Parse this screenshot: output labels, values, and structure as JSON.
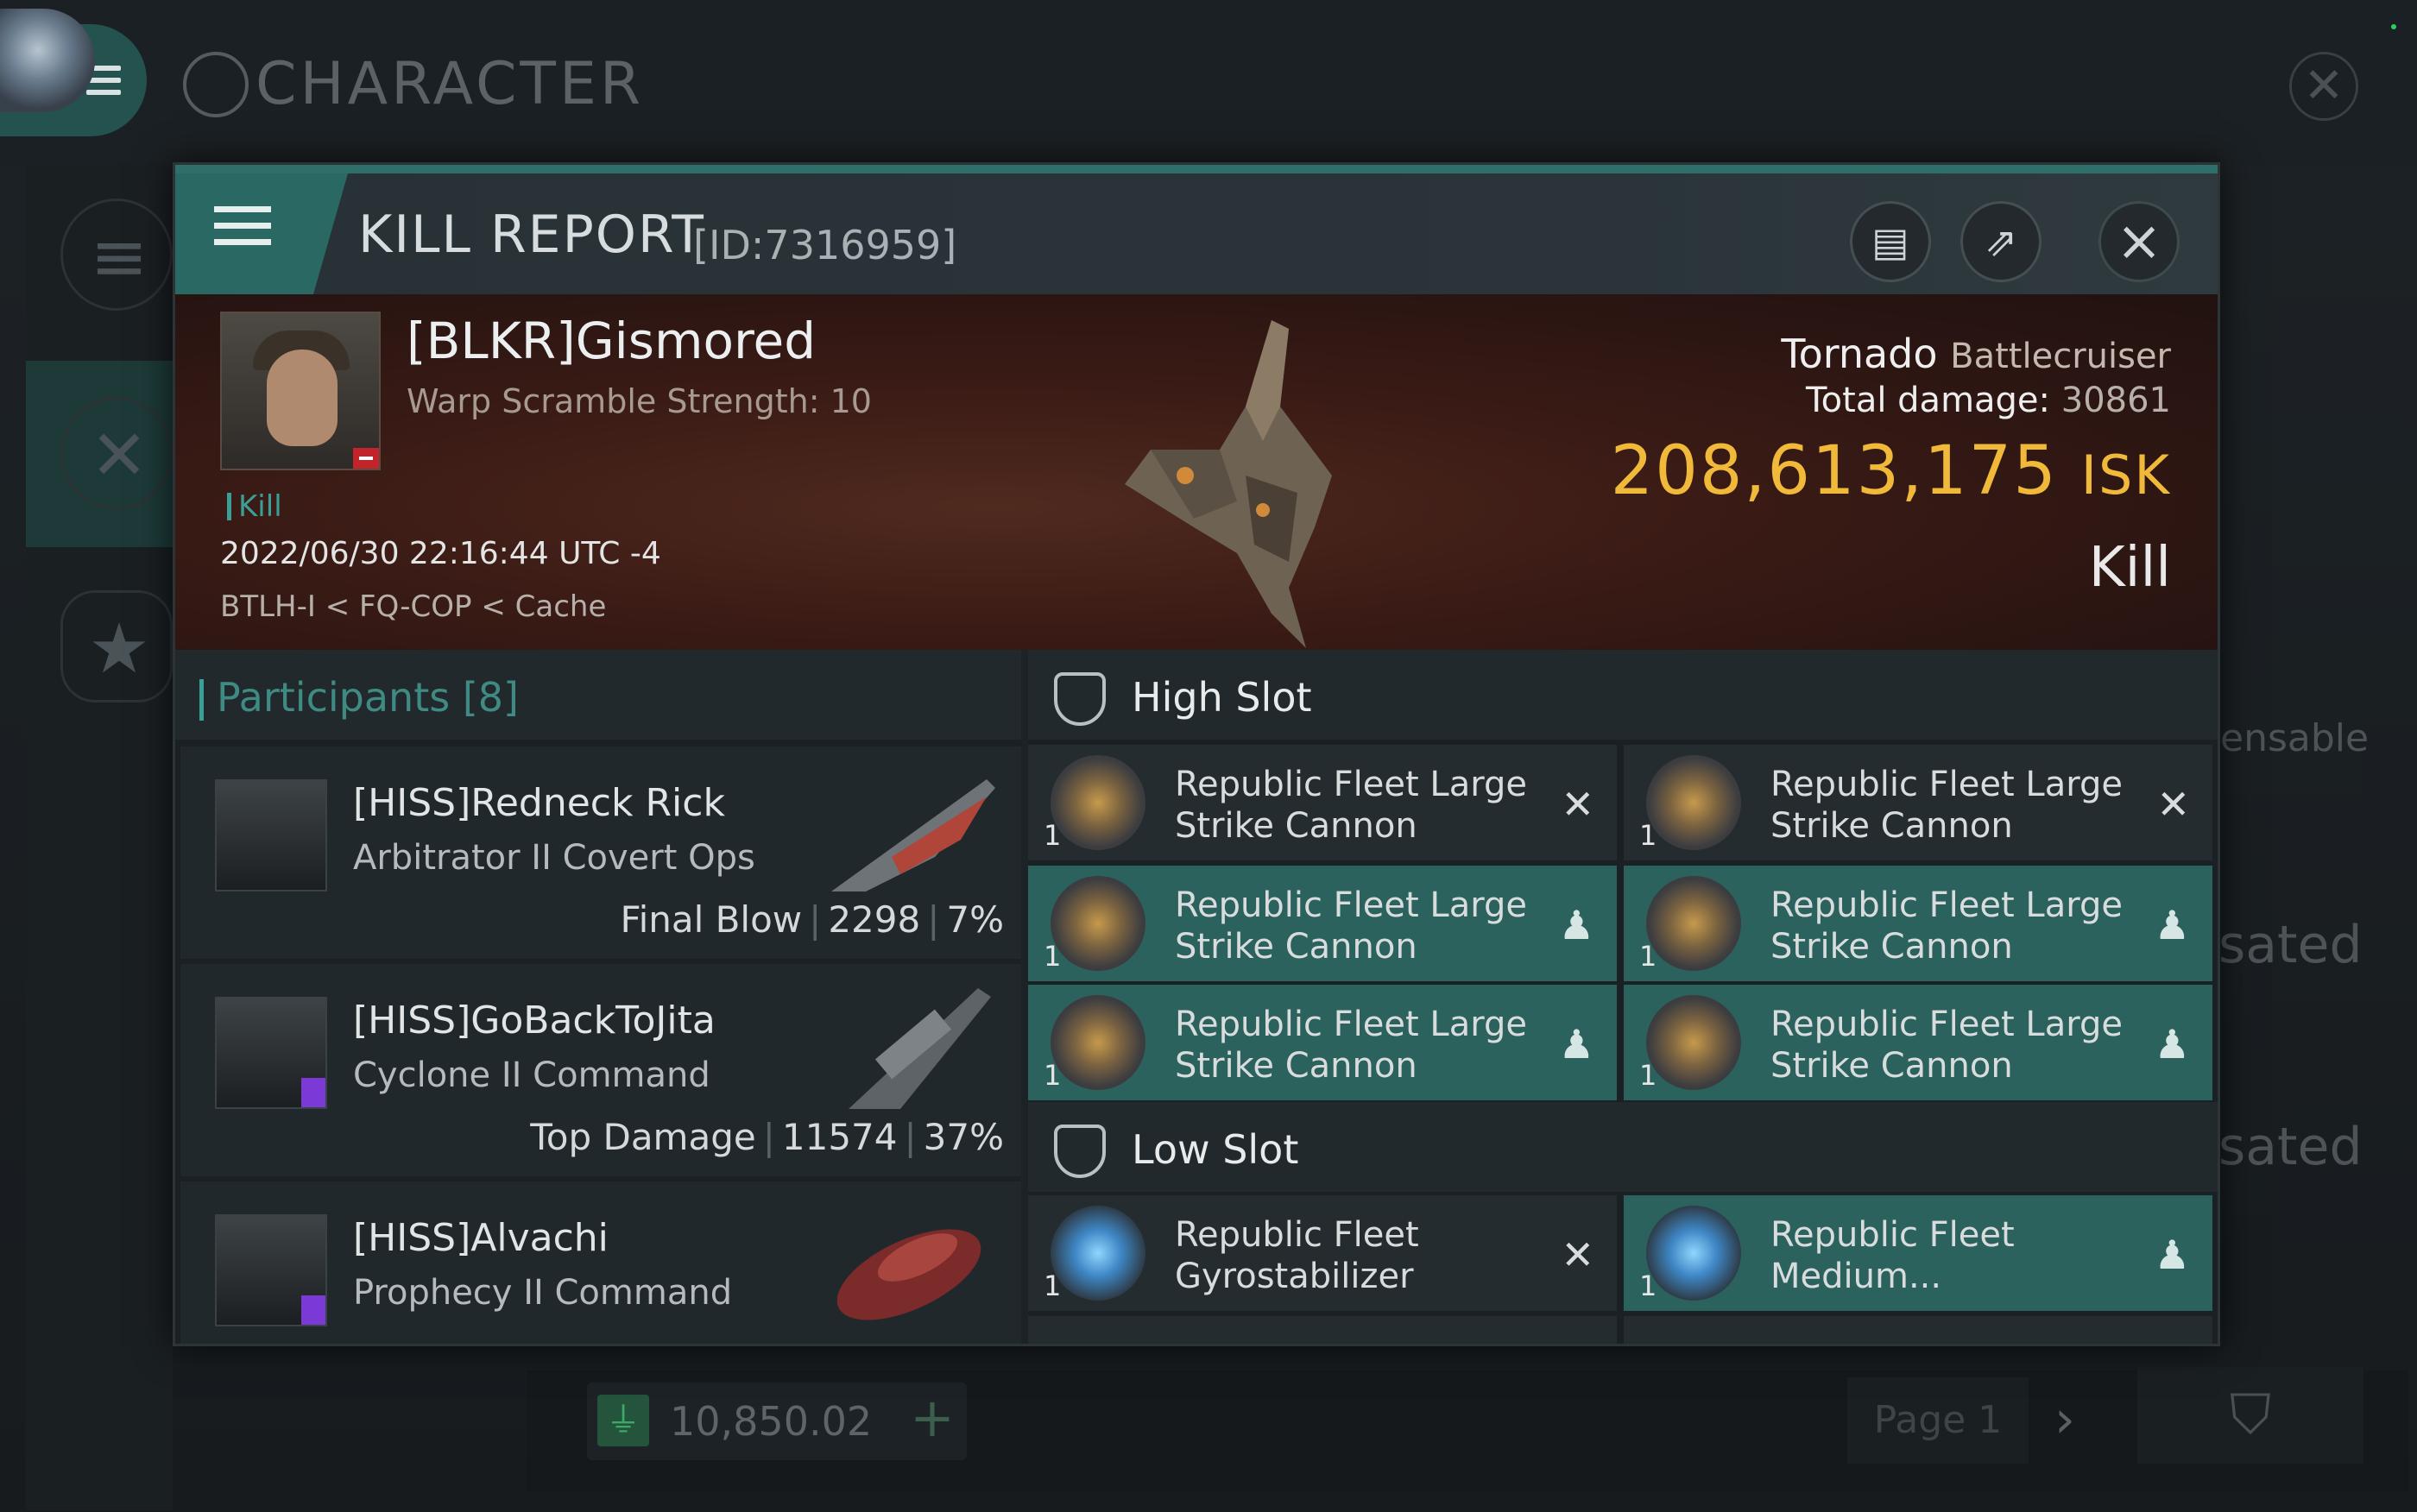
{
  "background": {
    "title": "CHARACTER",
    "right_texts": [
      "ensable",
      "sated",
      "sated"
    ],
    "wallet": "10,850.02",
    "page_label": "Page 1"
  },
  "kill_report": {
    "title": "KILL REPORT",
    "id_label": "[ID:7316959]",
    "victim": {
      "name": "[BLKR]Gismored",
      "warp_line": "Warp Scramble Strength: 10",
      "tag": "Kill",
      "datetime": "2022/06/30 22:16:44 UTC -4",
      "location": "BTLH-I < FQ-COP < Cache"
    },
    "ship": {
      "name": "Tornado",
      "class": "Battlecruiser",
      "total_damage_label": "Total damage:",
      "total_damage": "30861",
      "isk_value": "208,613,175",
      "isk_unit": "ISK",
      "result": "Kill"
    },
    "participants": {
      "label": "Participants",
      "count": "[8]",
      "rows": [
        {
          "name": "[HISS]Redneck Rick",
          "ship": "Arbitrator II Covert Ops",
          "stat_label": "Final Blow",
          "damage": "2298",
          "percent": "7%"
        },
        {
          "name": "[HISS]GoBackToJita",
          "ship": "Cyclone II Command",
          "stat_label": "Top Damage",
          "damage": "11574",
          "percent": "37%"
        },
        {
          "name": "[HISS]Alvachi",
          "ship": "Prophecy II Command",
          "stat_label": "",
          "damage": "",
          "percent": ""
        }
      ]
    },
    "high_slot": {
      "label": "High Slot",
      "modules": [
        {
          "name": "Republic Fleet Large Strike Cannon",
          "qty": "1",
          "state": "destroyed"
        },
        {
          "name": "Republic Fleet Large Strike Cannon",
          "qty": "1",
          "state": "destroyed"
        },
        {
          "name": "Republic Fleet Large Strike Cannon",
          "qty": "1",
          "state": "dropped"
        },
        {
          "name": "Republic Fleet Large Strike Cannon",
          "qty": "1",
          "state": "dropped"
        },
        {
          "name": "Republic Fleet Large Strike Cannon",
          "qty": "1",
          "state": "dropped"
        },
        {
          "name": "Republic Fleet Large Strike Cannon",
          "qty": "1",
          "state": "dropped"
        }
      ]
    },
    "low_slot": {
      "label": "Low Slot",
      "modules": [
        {
          "name": "Republic Fleet Gyrostabilizer",
          "qty": "1",
          "state": "destroyed"
        },
        {
          "name": "Republic Fleet Medium...",
          "qty": "1",
          "state": "dropped"
        }
      ]
    }
  },
  "icons": {
    "destroyed": "close-icon",
    "dropped": "person-icon"
  },
  "colors": {
    "accent": "#2a6864",
    "isk": "#f0b93a",
    "fitted_row": "#2b625e"
  }
}
